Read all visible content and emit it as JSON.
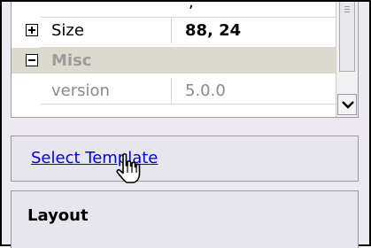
{
  "property_grid": {
    "rows": [
      {
        "expander": "plus",
        "name": "Size",
        "value": "88, 24"
      },
      {
        "expander": "minus",
        "name": "Misc",
        "value": ""
      },
      {
        "expander": "",
        "name": "version",
        "value": "5.0.0"
      }
    ]
  },
  "commands": {
    "link_label": "Select Template"
  },
  "description": {
    "title": "Layout"
  },
  "icons": {
    "expand": "plus-box-icon",
    "collapse": "minus-box-icon",
    "scroll_down": "chevron-down-icon",
    "cursor": "hand-pointer-cursor"
  },
  "colors": {
    "link": "#0000dd",
    "category_bg": "#dcd9cf",
    "panel_bg": "#e7e6ee"
  }
}
